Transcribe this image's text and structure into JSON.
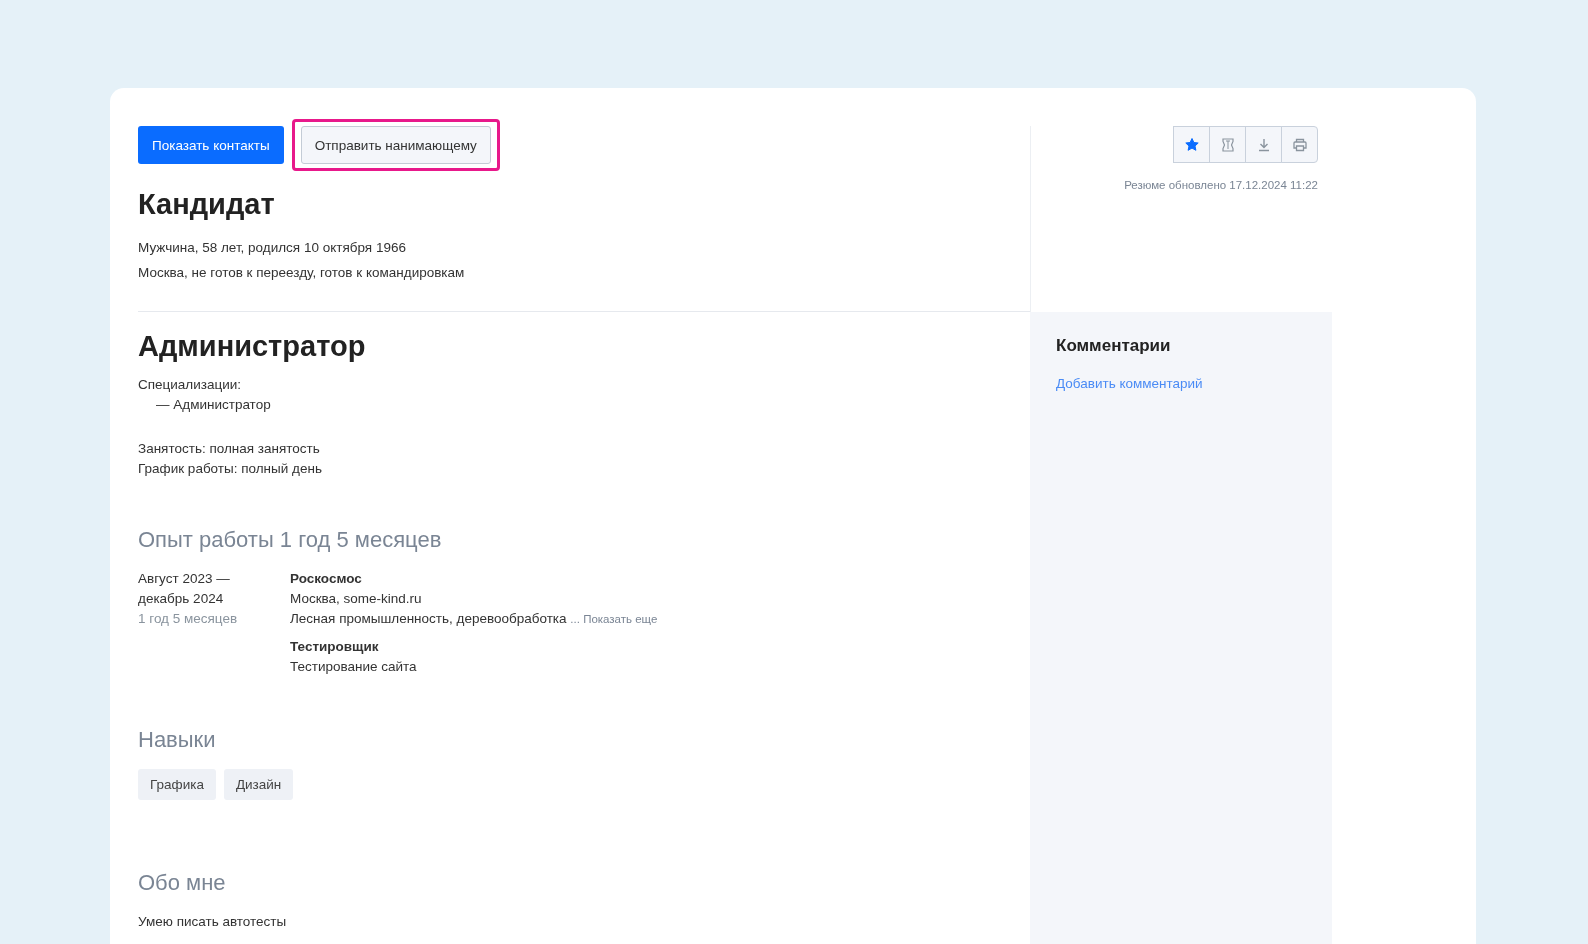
{
  "actions": [
    {
      "label": "Показать контакты",
      "kind": "primary",
      "highlighted": false
    },
    {
      "label": "Отправить нанимающему",
      "kind": "secondary",
      "highlighted": true
    }
  ],
  "toolbar": [
    {
      "kind": "star",
      "on": true
    },
    {
      "kind": "copy",
      "on": false
    },
    {
      "kind": "download",
      "on": false
    },
    {
      "kind": "print",
      "on": false
    }
  ],
  "updated": "Резюме обновлено 17.12.2024 11:22",
  "candidate": {
    "name": "Кандидат",
    "details": [
      "Мужчина, 58 лет, родился 10 октября 1966",
      "Москва, не готов к переезду, готов к командировкам"
    ]
  },
  "position": {
    "title": "Администратор",
    "specializations_label": "Специализации:",
    "specializations": [
      "— Администратор"
    ],
    "employment": "Занятость: полная занятость",
    "schedule": "График работы: полный день"
  },
  "experience": {
    "heading": "Опыт работы 1 год 5 месяцев",
    "jobs": [
      {
        "period": "Август 2023 — декабрь 2024",
        "duration": "1 год 5 месяцев",
        "company": "Роскосмос",
        "location": "Москва, some-kind.ru",
        "industry": "Лесная промышленность, деревообработка",
        "more": "... Показать еще",
        "role": "Тестировщик",
        "description": "Тестирование сайта"
      }
    ]
  },
  "skills": {
    "heading": "Навыки",
    "items": [
      "Графика",
      "Дизайн"
    ]
  },
  "about": {
    "heading": "Обо мне",
    "text": "Умею писать автотесты"
  },
  "comments": {
    "heading": "Комментарии",
    "link": "Добавить комментарий"
  }
}
